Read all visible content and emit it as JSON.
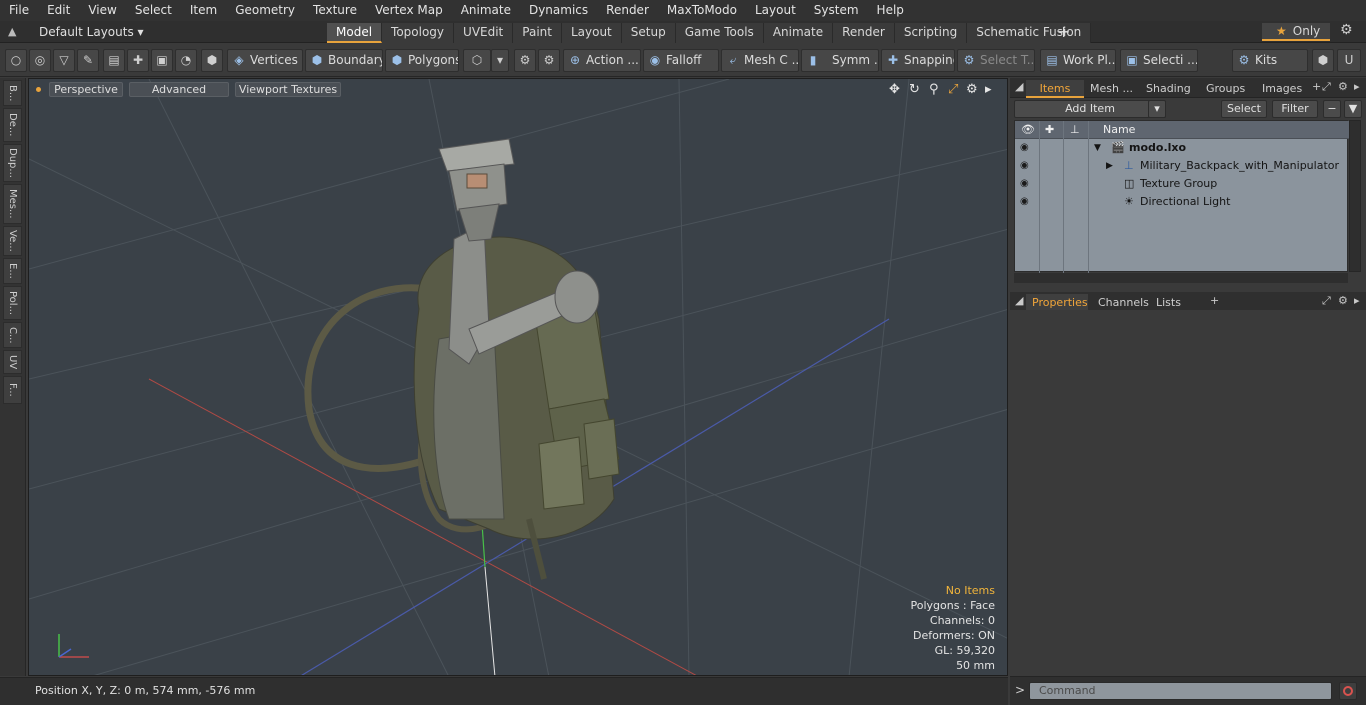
{
  "menu": [
    "File",
    "Edit",
    "View",
    "Select",
    "Item",
    "Geometry",
    "Texture",
    "Vertex Map",
    "Animate",
    "Dynamics",
    "Render",
    "MaxToModo",
    "Layout",
    "System",
    "Help"
  ],
  "layouts": {
    "dropdown_label": "Default Layouts",
    "tabs": [
      "Model",
      "Topology",
      "UVEdit",
      "Paint",
      "Layout",
      "Setup",
      "Game Tools",
      "Animate",
      "Render",
      "Scripting",
      "Schematic Fusion"
    ],
    "active_tab": "Model",
    "only_label": "Only"
  },
  "toolbar": {
    "vertices": "Vertices",
    "boundary": "Boundary",
    "polygons": "Polygons",
    "action": "Action ...",
    "falloff": "Falloff",
    "mesh": "Mesh C ...",
    "symm": "Symm ...",
    "snapping": "Snapping",
    "select_t": "Select T...",
    "work_plane": "Work Pl...",
    "selection": "Selecti ...",
    "kits": "Kits"
  },
  "left_strip": [
    "B...",
    "De...",
    "Dup...",
    "Mes...",
    "Ve...",
    "E...",
    "Pol...",
    "C...",
    "UV",
    "F..."
  ],
  "viewport": {
    "view_mode": "Perspective",
    "shading": "Advanced",
    "textures": "Viewport Textures",
    "info": {
      "selection": "No Items",
      "polygons": "Polygons : Face",
      "channels": "Channels: 0",
      "deformers": "Deformers: ON",
      "gl": "GL: 59,320",
      "scale": "50 mm"
    }
  },
  "status": {
    "position": "Position X, Y, Z:   0 m, 574 mm, -576 mm"
  },
  "items_panel": {
    "tabs": [
      "Items",
      "Mesh ...",
      "Shading",
      "Groups",
      "Images"
    ],
    "active_tab": "Items",
    "add_item": "Add Item",
    "select": "Select",
    "filter": "Filter",
    "column_name": "Name",
    "tree": [
      {
        "label": "modo.lxo",
        "level": 0
      },
      {
        "label": "Military_Backpack_with_Manipulator",
        "level": 1
      },
      {
        "label": "Texture Group",
        "level": 1
      },
      {
        "label": "Directional Light",
        "level": 1
      }
    ]
  },
  "properties_panel": {
    "tabs": [
      "Properties",
      "Channels",
      "Lists"
    ],
    "active_tab": "Properties"
  },
  "command": {
    "placeholder": "Command"
  },
  "colors": {
    "accent": "#e8a33c",
    "viewport_bg": "#3a4148",
    "list_bg": "#8b949d"
  }
}
